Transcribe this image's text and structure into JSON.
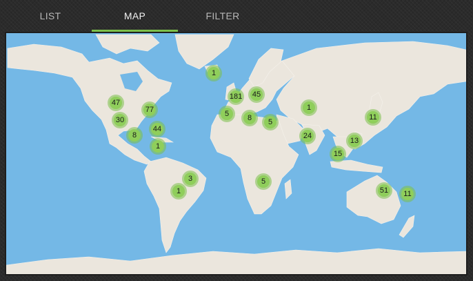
{
  "tabs": [
    {
      "id": "list",
      "label": "LIST",
      "active": false
    },
    {
      "id": "map",
      "label": "MAP",
      "active": true
    },
    {
      "id": "filter",
      "label": "FILTER",
      "active": false
    }
  ],
  "colors": {
    "accent": "#7cc04a",
    "ocean": "#74b8e6",
    "land": "#ebe6dd",
    "marker": "#8fce5b"
  },
  "map": {
    "clusters": [
      {
        "id": "iceland",
        "count": "1"
      },
      {
        "id": "uk",
        "count": "181"
      },
      {
        "id": "central-europe",
        "count": "45"
      },
      {
        "id": "canada-west",
        "count": "47"
      },
      {
        "id": "us-east",
        "count": "77"
      },
      {
        "id": "us-west",
        "count": "30"
      },
      {
        "id": "us-south",
        "count": "44"
      },
      {
        "id": "mexico",
        "count": "8"
      },
      {
        "id": "colombia",
        "count": "1"
      },
      {
        "id": "spain",
        "count": "5"
      },
      {
        "id": "italy",
        "count": "8"
      },
      {
        "id": "egypt",
        "count": "5"
      },
      {
        "id": "india",
        "count": "24"
      },
      {
        "id": "china",
        "count": "1"
      },
      {
        "id": "japan",
        "count": "11"
      },
      {
        "id": "southeast-asia",
        "count": "13"
      },
      {
        "id": "indonesia",
        "count": "15"
      },
      {
        "id": "brazil",
        "count": "3"
      },
      {
        "id": "argentina",
        "count": "1"
      },
      {
        "id": "south-africa",
        "count": "5"
      },
      {
        "id": "australia",
        "count": "51"
      },
      {
        "id": "new-zealand",
        "count": "11"
      }
    ]
  }
}
